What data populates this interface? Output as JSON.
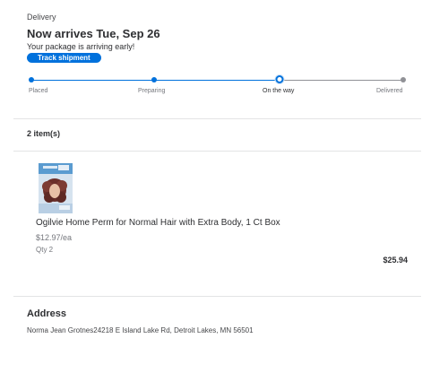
{
  "delivery": {
    "label": "Delivery",
    "arrival_title": "Now arrives Tue, Sep 26",
    "early_note": "Your package is arriving early!",
    "track_label": "Track shipment"
  },
  "progress": {
    "steps": [
      {
        "label": "Placed",
        "state": "done"
      },
      {
        "label": "Preparing",
        "state": "done"
      },
      {
        "label": "On the way",
        "state": "current"
      },
      {
        "label": "Delivered",
        "state": "upcoming"
      }
    ],
    "completed_fraction": 0.67
  },
  "items": {
    "count_label": "2 item(s)",
    "list": [
      {
        "name": "Ogilvie Home Perm for Normal Hair with Extra Body, 1 Ct Box",
        "unit_price": "$12.97/ea",
        "qty": "Qty 2",
        "total": "$25.94",
        "image_icon": "product-box-image"
      }
    ]
  },
  "address": {
    "heading": "Address",
    "text": "Norma Jean Grotnes24218 E Island Lake Rd, Detroit Lakes, MN 56501"
  },
  "colors": {
    "accent": "#0071dc",
    "inactive": "#909196",
    "text": "#2e2f32",
    "muted": "#74767c"
  }
}
